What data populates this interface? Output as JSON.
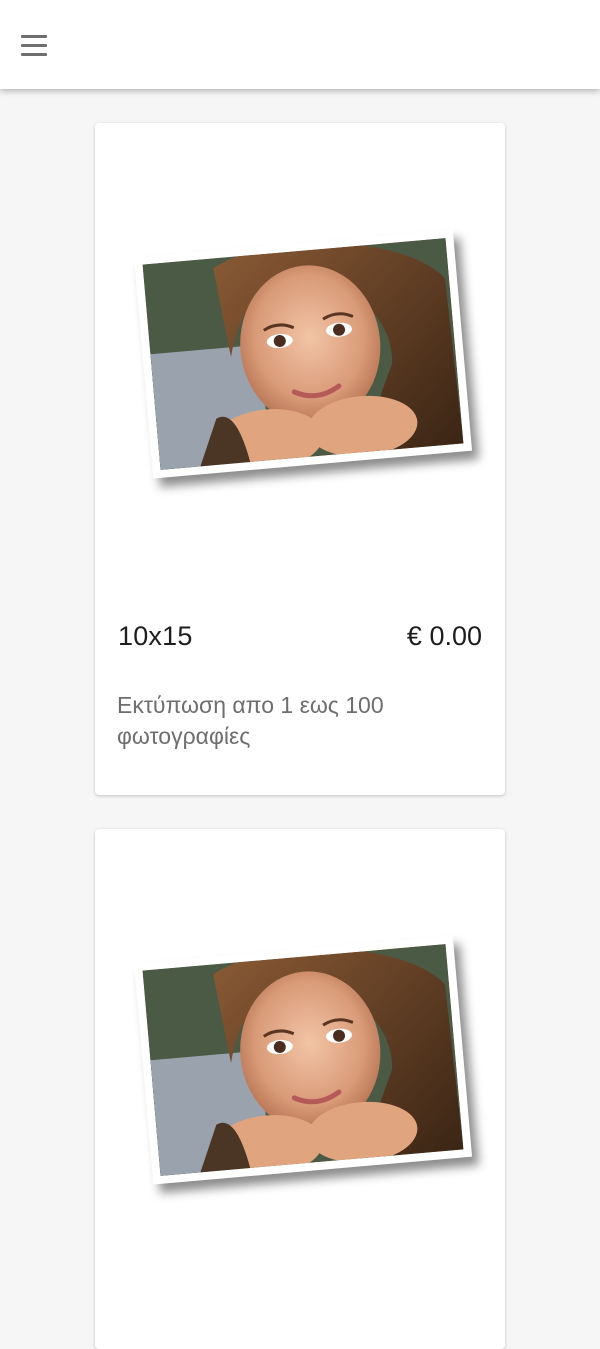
{
  "header": {
    "menu_icon": "hamburger-menu-icon"
  },
  "products": [
    {
      "title": "10x15",
      "price": "€ 0.00",
      "description": "Εκτύπωση απο 1 εως 100 φωτογραφίες",
      "image_icon": "photo-print-image"
    },
    {
      "image_icon": "photo-print-image"
    }
  ],
  "colors": {
    "background": "#f6f6f6",
    "card": "#ffffff",
    "text_primary": "#1e1e1e",
    "text_secondary": "#6e6e6e"
  }
}
